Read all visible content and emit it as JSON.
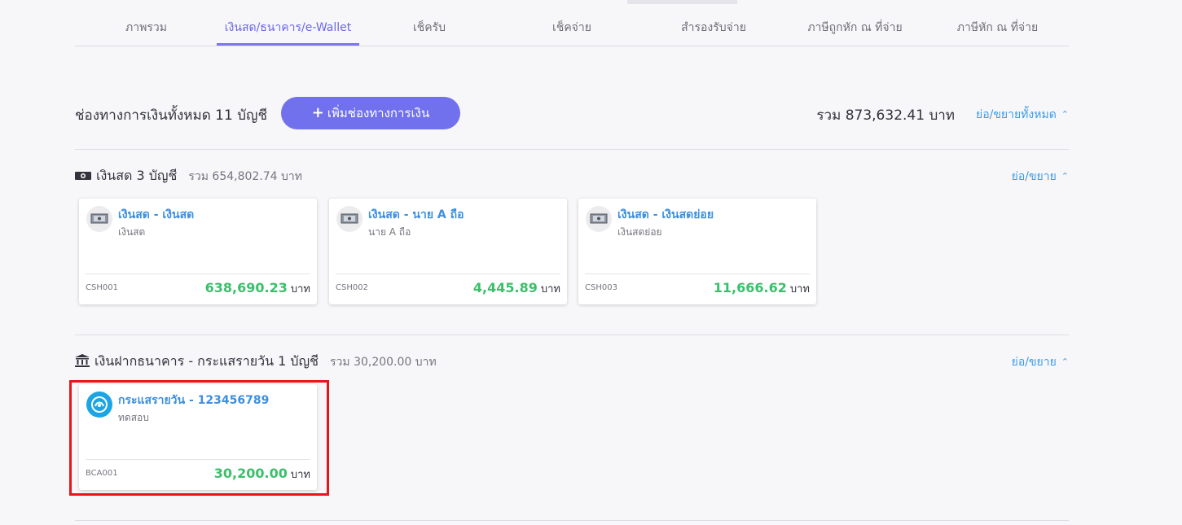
{
  "tabs": [
    {
      "label": "ภาพรวม"
    },
    {
      "label": "เงินสด/ธนาคาร/e-Wallet"
    },
    {
      "label": "เช็ครับ"
    },
    {
      "label": "เช็คจ่าย"
    },
    {
      "label": "สำรองรับจ่าย"
    },
    {
      "label": "ภาษีถูกหัก ณ ที่จ่าย"
    },
    {
      "label": "ภาษีหัก ณ ที่จ่าย"
    }
  ],
  "active_tab": "เงินสด/ธนาคาร/e-Wallet",
  "header": {
    "title": "ช่องทางการเงินทั้งหมด 11 บัญชี",
    "add_button": "เพิ่มช่องทางการเงิน",
    "total": "รวม 873,632.41 บาท",
    "collapse_all": "ย่อ/ขยายทั้งหมด"
  },
  "groups": [
    {
      "title": "เงินสด 3 บัญชี",
      "subtotal": "รวม 654,802.74 บาท",
      "toggle": "ย่อ/ขยาย",
      "icon": "cash-icon",
      "cards": [
        {
          "title": "เงินสด - เงินสด",
          "desc": "เงินสด",
          "code": "CSH001",
          "amount": "638,690.23",
          "unit": "บาท",
          "icon": "money-icon"
        },
        {
          "title": "เงินสด - นาย A ถือ",
          "desc": "นาย A ถือ",
          "code": "CSH002",
          "amount": "4,445.89",
          "unit": "บาท",
          "icon": "money-icon"
        },
        {
          "title": "เงินสด - เงินสดย่อย",
          "desc": "เงินสดย่อย",
          "code": "CSH003",
          "amount": "11,666.62",
          "unit": "บาท",
          "icon": "money-icon"
        }
      ]
    },
    {
      "title": "เงินฝากธนาคาร - กระแสรายวัน 1 บัญชี",
      "subtotal": "รวม 30,200.00 บาท",
      "toggle": "ย่อ/ขยาย",
      "icon": "bank-icon",
      "cards": [
        {
          "title": "กระแสรายวัน - 123456789",
          "desc": "ทดสอบ",
          "code": "BCA001",
          "amount": "30,200.00",
          "unit": "บาท",
          "icon": "bank-logo-icon"
        }
      ]
    }
  ],
  "colors": {
    "accent": "#7170ed",
    "link": "#3d9be9",
    "amount": "#3cbf6a",
    "highlight": "#e8141a"
  }
}
